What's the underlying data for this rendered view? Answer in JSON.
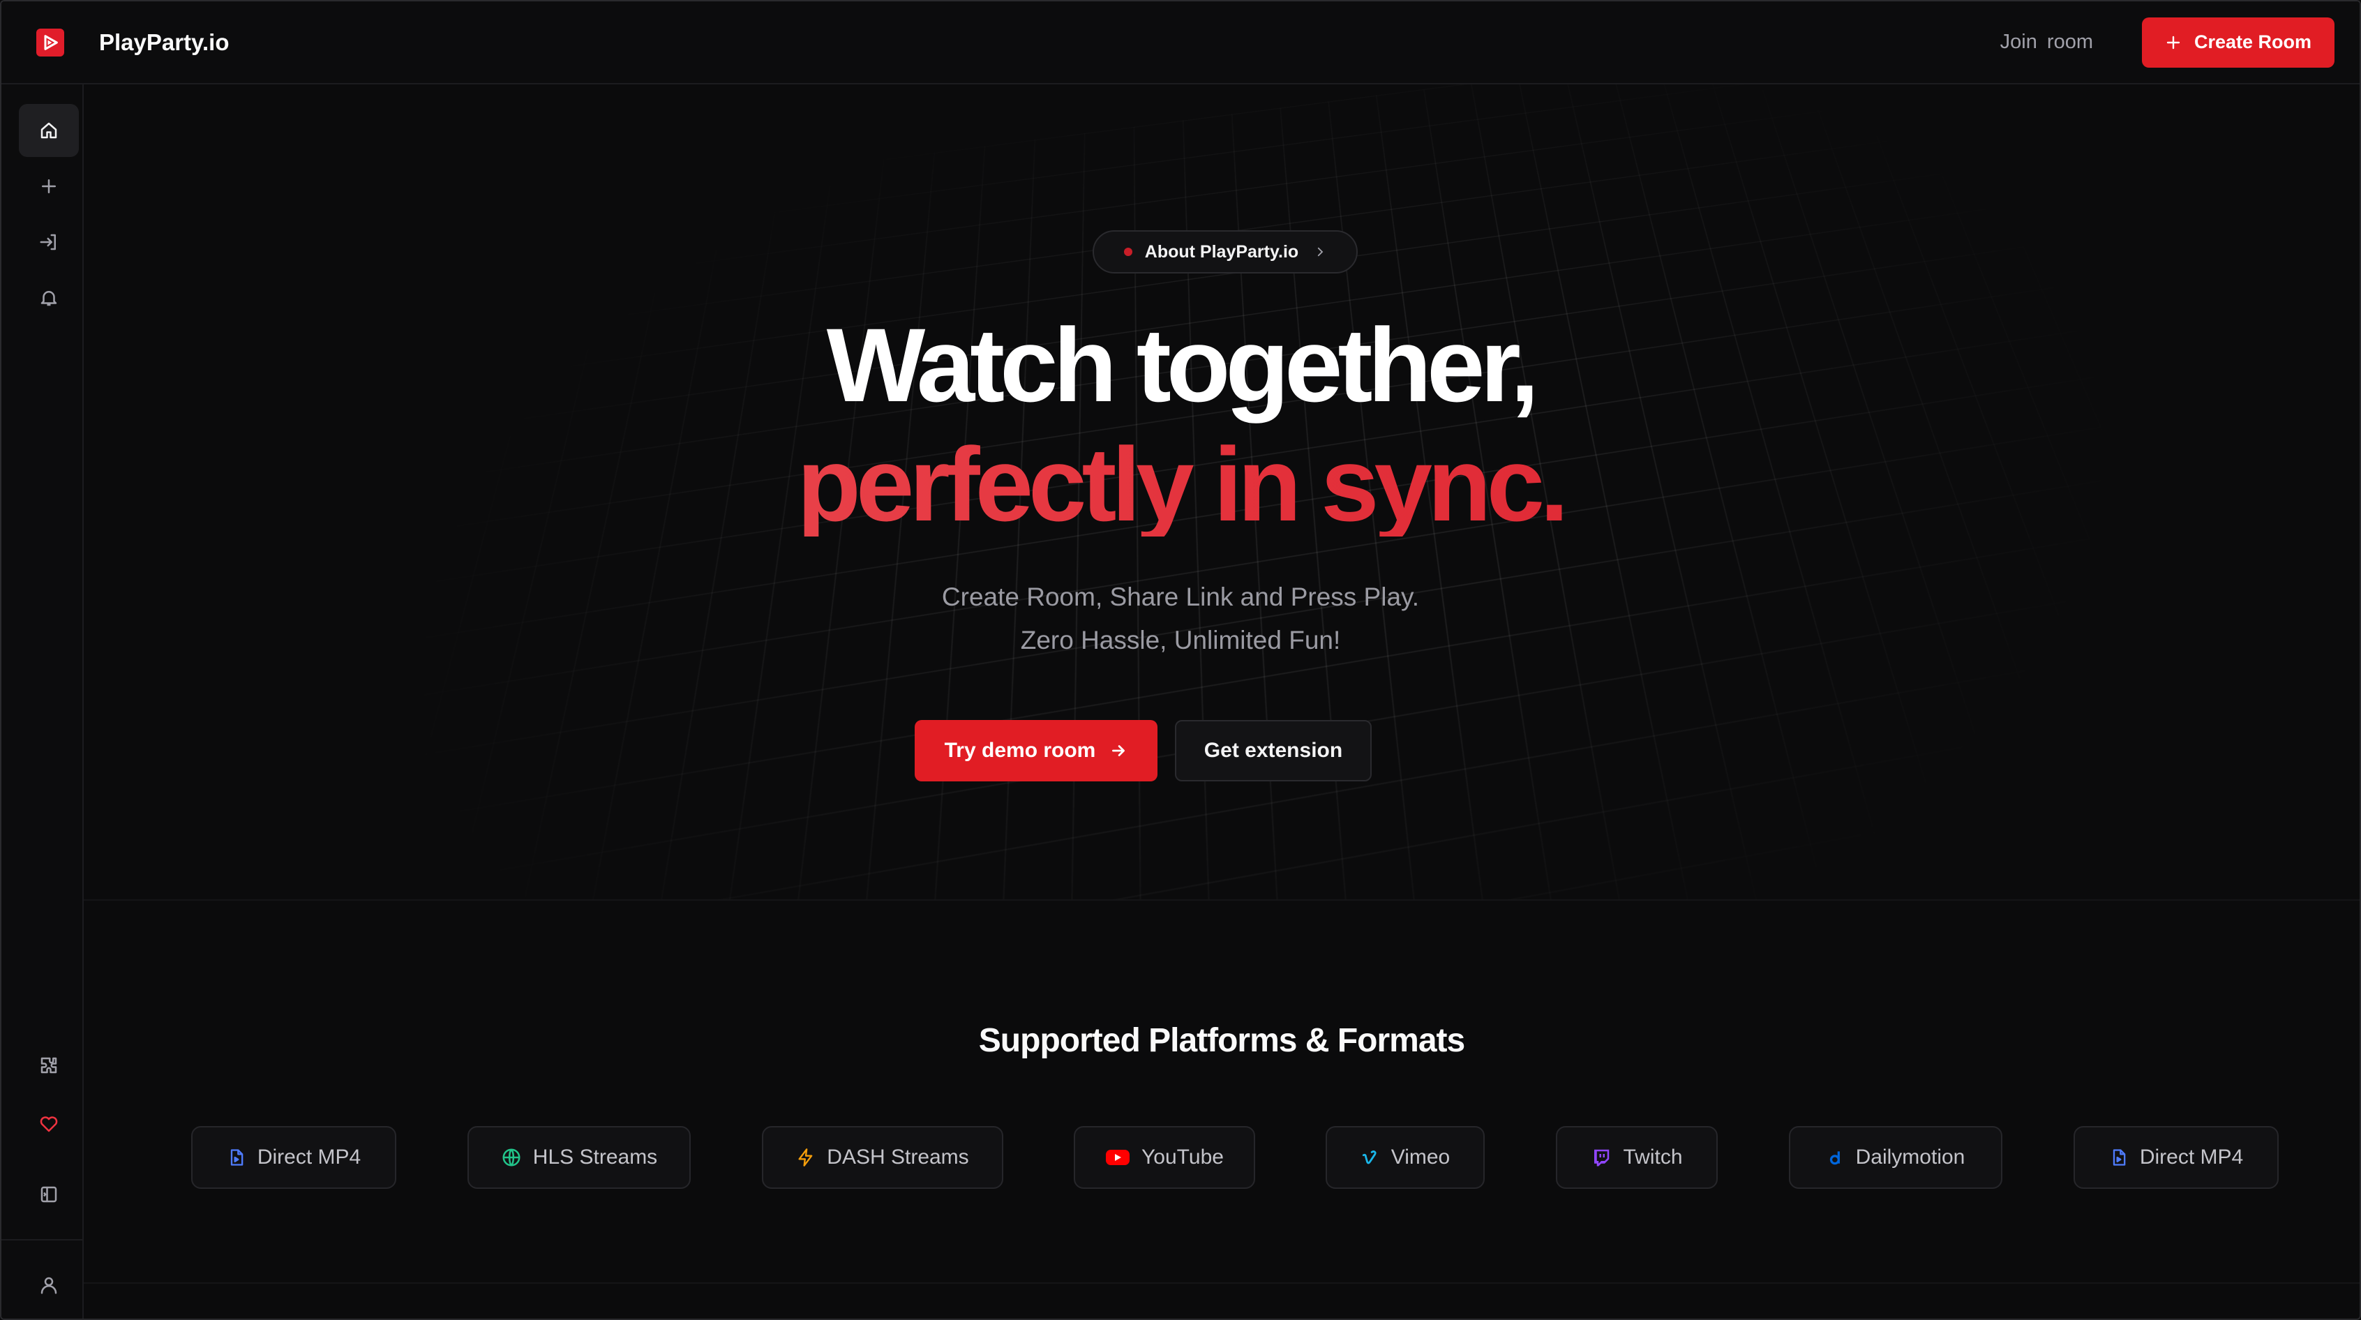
{
  "header": {
    "brand_name": "PlayParty.io",
    "join_label": "Join  room",
    "create_label": "Create Room"
  },
  "sidebar": {
    "items": [
      {
        "name": "home",
        "icon": "home-icon",
        "active": true
      },
      {
        "name": "create",
        "icon": "plus-icon",
        "active": false
      },
      {
        "name": "join",
        "icon": "login-icon",
        "active": false
      },
      {
        "name": "notifications",
        "icon": "bell-icon",
        "active": false
      },
      {
        "name": "extensions",
        "icon": "puzzle-icon",
        "active": false
      },
      {
        "name": "favorites",
        "icon": "heart-icon",
        "active": false
      },
      {
        "name": "toggle-panel",
        "icon": "panel-icon",
        "active": false
      },
      {
        "name": "profile",
        "icon": "user-icon",
        "active": false
      }
    ]
  },
  "hero": {
    "pill_label": "About PlayParty.io",
    "headline_line1": "Watch together,",
    "headline_line2": "perfectly in sync.",
    "sub_line1": "Create Room, Share Link and Press Play.",
    "sub_line2": "Zero Hassle, Unlimited Fun!",
    "primary_cta": "Try demo room",
    "secondary_cta": "Get extension"
  },
  "platforms": {
    "title": "Supported Platforms & Formats",
    "items": [
      {
        "label": "Direct MP4",
        "icon": "file-video-icon",
        "color": "#4f7cff"
      },
      {
        "label": "HLS Streams",
        "icon": "globe-icon",
        "color": "#22c58b"
      },
      {
        "label": "DASH Streams",
        "icon": "bolt-icon",
        "color": "#f59e0b"
      },
      {
        "label": "YouTube",
        "icon": "youtube-icon",
        "color": "#ff0000"
      },
      {
        "label": "Vimeo",
        "icon": "vimeo-icon",
        "color": "#1ab7ea"
      },
      {
        "label": "Twitch",
        "icon": "twitch-icon",
        "color": "#9146ff"
      },
      {
        "label": "Dailymotion",
        "icon": "dailymotion-icon",
        "color": "#0066dc"
      },
      {
        "label": "Direct MP4",
        "icon": "file-video-icon",
        "color": "#4f7cff"
      }
    ]
  },
  "colors": {
    "accent": "#e11d24",
    "background": "#0b0b0c"
  }
}
